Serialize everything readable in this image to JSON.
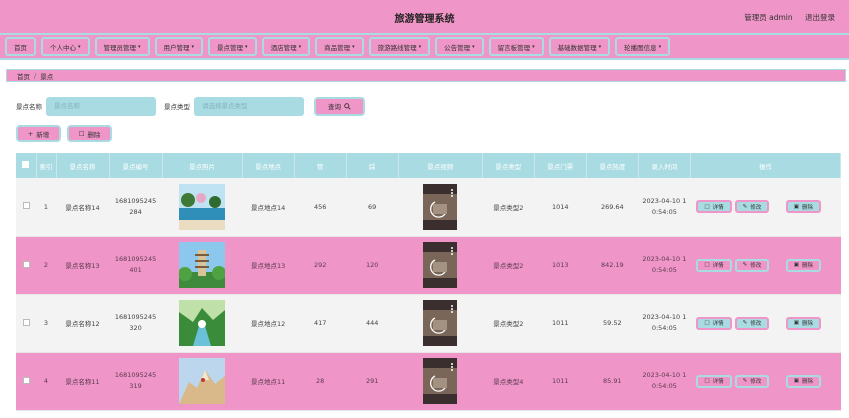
{
  "app": {
    "title": "旅游管理系统",
    "admin_label": "管理员 admin",
    "logout_label": "退出登录"
  },
  "nav": [
    {
      "label": "首页",
      "caret": false
    },
    {
      "label": "个人中心",
      "caret": true
    },
    {
      "label": "管理员管理",
      "caret": true
    },
    {
      "label": "用户管理",
      "caret": true
    },
    {
      "label": "景点管理",
      "caret": true
    },
    {
      "label": "酒店管理",
      "caret": true
    },
    {
      "label": "商品管理",
      "caret": true
    },
    {
      "label": "旅游路线管理",
      "caret": true
    },
    {
      "label": "公告管理",
      "caret": true
    },
    {
      "label": "留言板管理",
      "caret": true
    },
    {
      "label": "基础数据管理",
      "caret": true
    },
    {
      "label": "轮播图信息",
      "caret": true
    }
  ],
  "breadcrumb": {
    "home": "首页",
    "sep": "/",
    "current": "景点"
  },
  "search": {
    "name_label": "景点名称",
    "name_placeholder": "景点名称",
    "type_label": "景点类型",
    "type_placeholder": "请选择景点类型",
    "button": "查询",
    "button_icon": "search-icon"
  },
  "actions": {
    "add": "新增",
    "delete": "删除"
  },
  "columns": [
    "",
    "索引",
    "景点名称",
    "景点编号",
    "景点照片",
    "景点地点",
    "赞",
    "踩",
    "景点视频",
    "景点类型",
    "景点门票",
    "景点热度",
    "录入时间",
    "操作"
  ],
  "rows": [
    {
      "idx": "1",
      "name": "景点名称14",
      "code": "1681095245284",
      "place": "景点地点14",
      "up": "456",
      "down": "69",
      "type": "景点类型2",
      "price": "1014",
      "heat": "269.64",
      "time": "2023-04-10 10:54:05",
      "photo": "beach"
    },
    {
      "idx": "2",
      "name": "景点名称13",
      "code": "1681095245401",
      "place": "景点地点13",
      "up": "292",
      "down": "120",
      "type": "景点类型2",
      "price": "1013",
      "heat": "842.19",
      "time": "2023-04-10 10:54:05",
      "photo": "pagoda"
    },
    {
      "idx": "3",
      "name": "景点名称12",
      "code": "1681095245320",
      "place": "景点地点12",
      "up": "417",
      "down": "444",
      "type": "景点类型2",
      "price": "1011",
      "heat": "59.52",
      "time": "2023-04-10 10:54:05",
      "photo": "valley"
    },
    {
      "idx": "4",
      "name": "景点名称11",
      "code": "1681095245319",
      "place": "景点地点11",
      "up": "28",
      "down": "291",
      "type": "景点类型4",
      "price": "1011",
      "heat": "85.91",
      "time": "2023-04-10 10:54:05",
      "photo": "mountain"
    }
  ],
  "row_ops": {
    "detail": "详情",
    "edit": "修改",
    "delete": "删除"
  },
  "colors": {
    "pink": "#ef95c7",
    "cyan": "#a9dbe3"
  }
}
